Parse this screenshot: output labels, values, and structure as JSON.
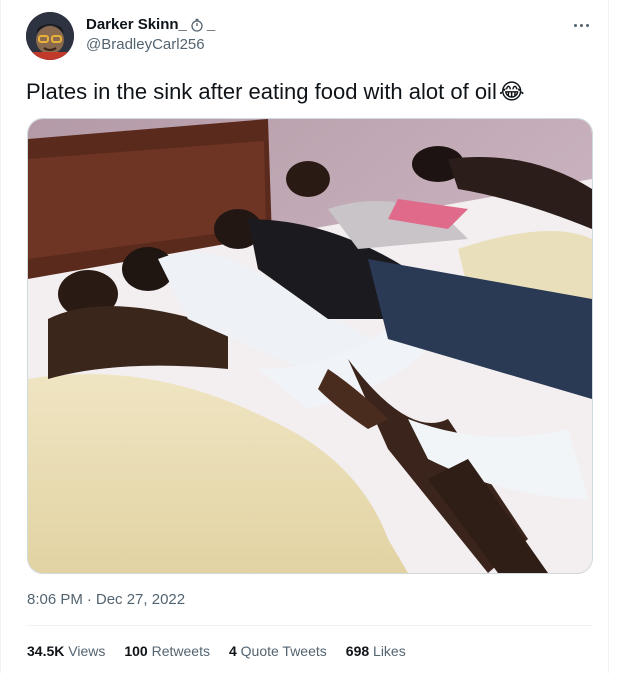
{
  "user": {
    "display_name": "Darker Skinn_",
    "display_name_suffix": "_",
    "handle": "@BradleyCarl256"
  },
  "tweet": {
    "text": "Plates in the sink after eating food with alot of oil",
    "emoji": "😂"
  },
  "meta": {
    "time": "8:06 PM",
    "separator": "·",
    "date": "Dec 27, 2022"
  },
  "stats": [
    {
      "value": "34.5K",
      "label": "Views"
    },
    {
      "value": "100",
      "label": "Retweets"
    },
    {
      "value": "4",
      "label": "Quote Tweets"
    },
    {
      "value": "698",
      "label": "Likes"
    }
  ],
  "icons": {
    "more": "more-horizontal-icon",
    "stopwatch": "stopwatch-icon"
  },
  "colors": {
    "primary_text": "#0f1419",
    "secondary_text": "#536471",
    "border": "#cfd9de"
  }
}
